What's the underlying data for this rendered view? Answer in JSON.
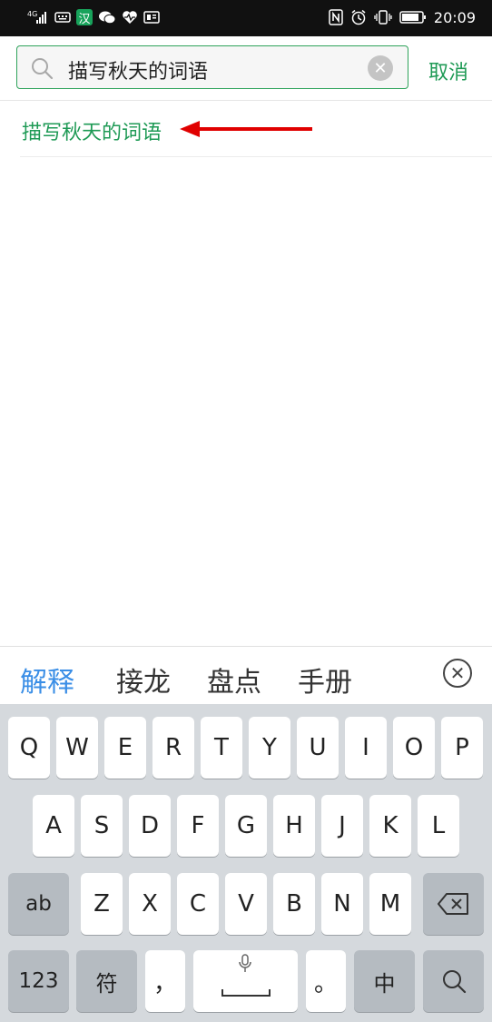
{
  "status_bar": {
    "network_label": "4G",
    "han_badge": "汉",
    "time": "20:09"
  },
  "search": {
    "query": "描写秋天的词语",
    "cancel_label": "取消"
  },
  "suggestions": [
    {
      "text": "描写秋天的词语"
    }
  ],
  "colors": {
    "accent_green": "#1e9a55",
    "arrow_red": "#e00000",
    "candidate_active_blue": "#3a8ee6"
  },
  "candidate_bar": {
    "items": [
      "解释",
      "接龙",
      "盘点",
      "手册"
    ]
  },
  "keyboard": {
    "row1": [
      "Q",
      "W",
      "E",
      "R",
      "T",
      "Y",
      "U",
      "I",
      "O",
      "P"
    ],
    "row2": [
      "A",
      "S",
      "D",
      "F",
      "G",
      "H",
      "J",
      "K",
      "L"
    ],
    "row3": [
      "ab",
      "Z",
      "X",
      "C",
      "V",
      "B",
      "N",
      "M"
    ],
    "row4": [
      "123",
      "符",
      "，",
      "。",
      "中"
    ]
  },
  "icons": {
    "search": "magnifier-icon",
    "clear": "clear-circle-icon",
    "close_candidates": "close-circle-icon",
    "backspace": "backspace-icon",
    "microphone": "microphone-icon",
    "search_key": "search-key-icon"
  }
}
